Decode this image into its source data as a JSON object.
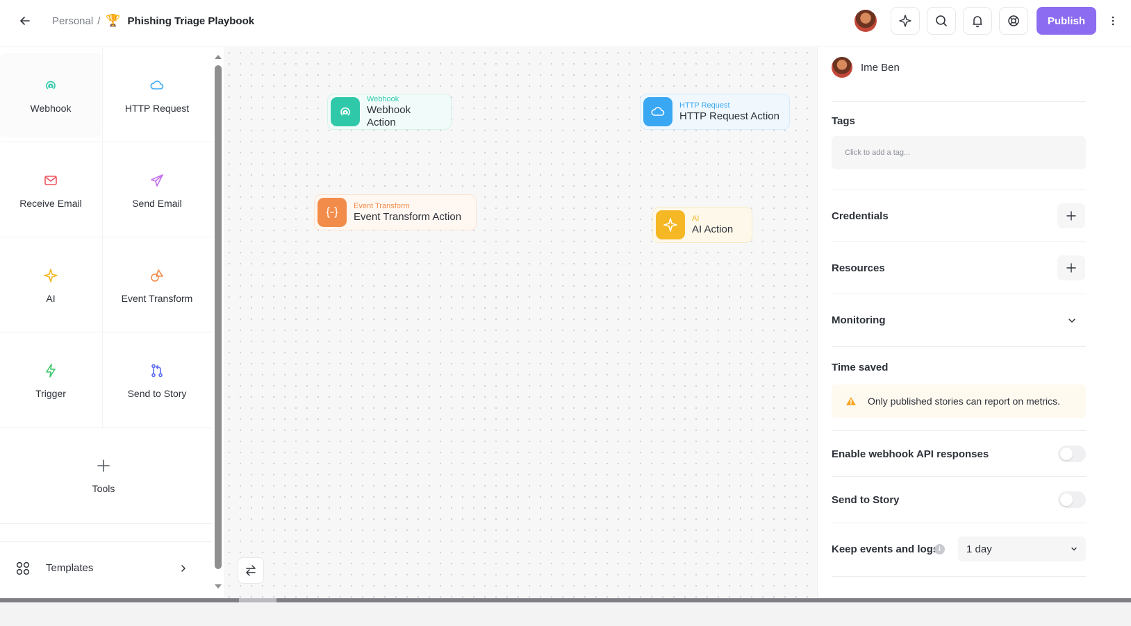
{
  "header": {
    "breadcrumb_parent": "Personal",
    "breadcrumb_sep": "/",
    "title_emoji": "🏆",
    "title": "Phishing Triage Playbook",
    "publish_label": "Publish"
  },
  "palette": {
    "items": [
      {
        "label": "Webhook",
        "icon": "webhook-icon",
        "color": "#2fc9a9"
      },
      {
        "label": "HTTP Request",
        "icon": "cloud-icon",
        "color": "#3aa7f3"
      },
      {
        "label": "Receive Email",
        "icon": "mail-icon",
        "color": "#f0535f"
      },
      {
        "label": "Send Email",
        "icon": "send-icon",
        "color": "#c56ef0"
      },
      {
        "label": "AI",
        "icon": "sparkle-icon",
        "color": "#f5b723"
      },
      {
        "label": "Event Transform",
        "icon": "shapes-icon",
        "color": "#f28c4a"
      },
      {
        "label": "Trigger",
        "icon": "bolt-icon",
        "color": "#3cc56b"
      },
      {
        "label": "Send to Story",
        "icon": "git-branch-icon",
        "color": "#5b6cf0"
      },
      {
        "label": "Tools",
        "icon": "plus-icon",
        "color": "#555a63"
      }
    ],
    "templates_label": "Templates"
  },
  "canvas": {
    "nodes": [
      {
        "type": "Webhook",
        "name": "Webhook Action",
        "accent": "#2fc9a9"
      },
      {
        "type": "HTTP Request",
        "name": "HTTP Request Action",
        "accent": "#3aa7f3"
      },
      {
        "type": "Event Transform",
        "name": "Event Transform Action",
        "accent": "#f28c4a"
      },
      {
        "type": "AI",
        "name": "AI Action",
        "accent": "#f5b723"
      }
    ]
  },
  "panel": {
    "owner_name": "Ime Ben",
    "tags_label": "Tags",
    "tags_placeholder": "Click to add a tag...",
    "credentials_label": "Credentials",
    "resources_label": "Resources",
    "monitoring_label": "Monitoring",
    "time_saved_label": "Time saved",
    "time_saved_warning": "Only published stories can report on metrics.",
    "webhook_api_label": "Enable webhook API responses",
    "webhook_api_enabled": false,
    "send_to_story_label": "Send to Story",
    "send_to_story_enabled": false,
    "keep_events_label": "Keep events and logs",
    "keep_events_value": "1 day"
  },
  "colors": {
    "publish": "#8c6cf0",
    "warning": "#f5a623"
  }
}
